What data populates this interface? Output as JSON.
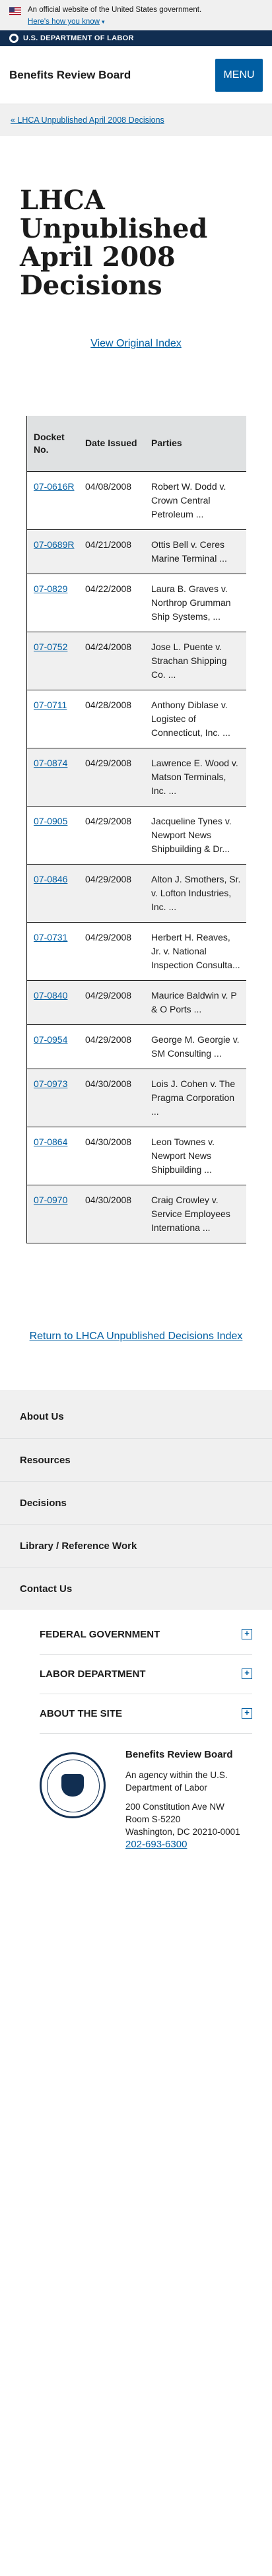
{
  "gov_banner": {
    "text": "An official website of the United States government.",
    "how_link": "Here's how you know",
    "chevron": "▾"
  },
  "dol_strip": {
    "name": "U.S. DEPARTMENT OF LABOR"
  },
  "header": {
    "site_title": "Benefits Review Board",
    "menu_label": "MENU"
  },
  "breadcrumb": {
    "back_link": "« LHCA Unpublished April 2008 Decisions"
  },
  "main": {
    "title": "LHCA Unpublished April 2008 Decisions",
    "original_index_link": "View Original Index",
    "table": {
      "headers": [
        "Docket No.",
        "Date Issued",
        "Parties"
      ],
      "rows": [
        {
          "docket": "07-0616R",
          "date": "04/08/2008",
          "parties": "Robert W. Dodd v. Crown Central Petroleum ..."
        },
        {
          "docket": "07-0689R",
          "date": "04/21/2008",
          "parties": "Ottis Bell v. Ceres Marine Terminal ..."
        },
        {
          "docket": "07-0829",
          "date": "04/22/2008",
          "parties": "Laura B. Graves v. Northrop Grumman Ship Systems, ..."
        },
        {
          "docket": "07-0752",
          "date": "04/24/2008",
          "parties": "Jose L. Puente v. Strachan Shipping Co. ..."
        },
        {
          "docket": "07-0711",
          "date": "04/28/2008",
          "parties": "Anthony Diblase v. Logistec of Connecticut, Inc. ..."
        },
        {
          "docket": "07-0874",
          "date": "04/29/2008",
          "parties": "Lawrence E. Wood v. Matson Terminals, Inc. ..."
        },
        {
          "docket": "07-0905",
          "date": "04/29/2008",
          "parties": "Jacqueline Tynes v. Newport News Shipbuilding & Dr..."
        },
        {
          "docket": "07-0846",
          "date": "04/29/2008",
          "parties": "Alton J. Smothers, Sr. v. Lofton Industries, Inc. ..."
        },
        {
          "docket": "07-0731",
          "date": "04/29/2008",
          "parties": "Herbert H. Reaves, Jr. v. National Inspection Consulta..."
        },
        {
          "docket": "07-0840",
          "date": "04/29/2008",
          "parties": "Maurice Baldwin v. P & O Ports ..."
        },
        {
          "docket": "07-0954",
          "date": "04/29/2008",
          "parties": "George M. Georgie v. SM Consulting ..."
        },
        {
          "docket": "07-0973",
          "date": "04/30/2008",
          "parties": "Lois J. Cohen v. The Pragma Corporation ..."
        },
        {
          "docket": "07-0864",
          "date": "04/30/2008",
          "parties": "Leon Townes v. Newport News Shipbuilding ..."
        },
        {
          "docket": "07-0970",
          "date": "04/30/2008",
          "parties": "Craig Crowley v. Service Employees Internationa ..."
        }
      ]
    },
    "return_link": "Return to LHCA Unpublished Decisions Index"
  },
  "footer_nav": [
    "About Us",
    "Resources",
    "Decisions",
    "Library / Reference Work",
    "Contact Us"
  ],
  "accordion": [
    "FEDERAL GOVERNMENT",
    "LABOR DEPARTMENT",
    "ABOUT THE SITE"
  ],
  "agency": {
    "name": "Benefits Review Board",
    "description": "An agency within the U.S. Department of Labor",
    "address_line1": "200 Constitution Ave NW",
    "address_line2": "Room S-5220",
    "address_line3": "Washington, DC 20210-0001",
    "phone": "202-693-6300"
  },
  "colors": {
    "link": "#005ea2",
    "dol_navy": "#112e51",
    "banner_gray": "#f0f0f0"
  }
}
